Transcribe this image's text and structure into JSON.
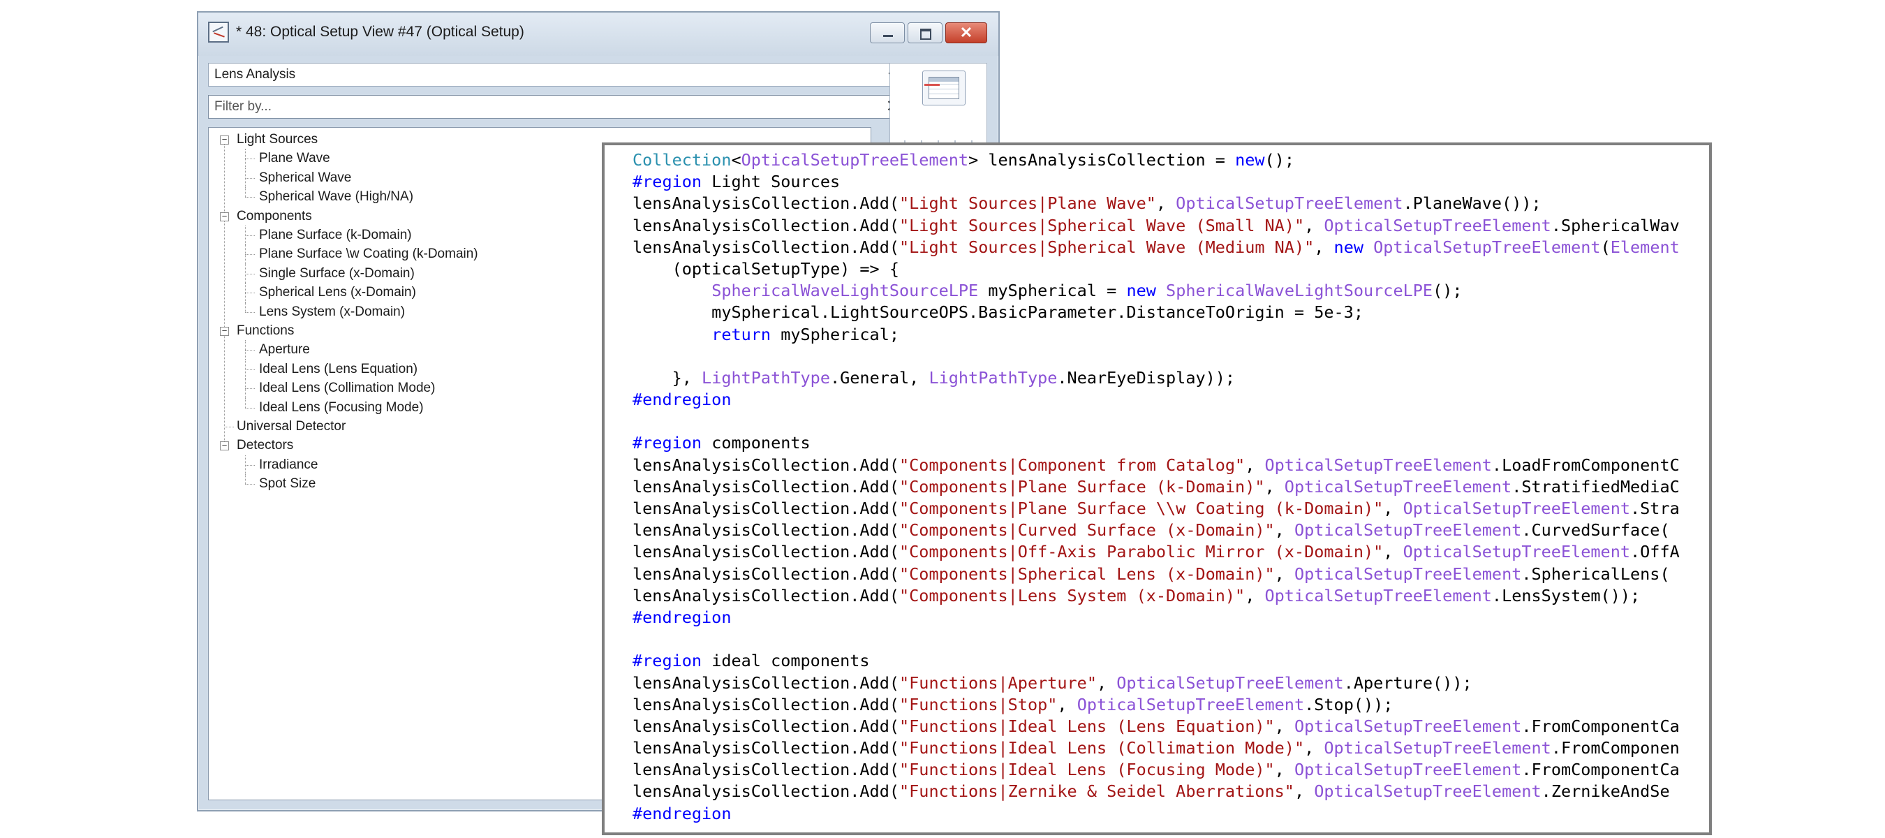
{
  "window": {
    "title": "* 48: Optical Setup View #47 (Optical Setup)"
  },
  "toolbar": {
    "dropdown_value": "Lens Analysis",
    "filter_placeholder": "Filter by...",
    "clear_glyph": "✕"
  },
  "icons": [
    "app-icon",
    "minimize-icon",
    "maximize-icon",
    "close-icon",
    "chevron-down-icon",
    "new-document-icon",
    "table-grid-icon"
  ],
  "tree": [
    {
      "label": "Light Sources",
      "level": 0,
      "expandable": true
    },
    {
      "label": "Plane Wave",
      "level": 1
    },
    {
      "label": "Spherical Wave",
      "level": 1
    },
    {
      "label": "Spherical Wave (High/NA)",
      "level": 1
    },
    {
      "label": "Components",
      "level": 0,
      "expandable": true
    },
    {
      "label": "Plane Surface (k-Domain)",
      "level": 1
    },
    {
      "label": "Plane Surface \\w Coating (k-Domain)",
      "level": 1
    },
    {
      "label": "Single Surface (x-Domain)",
      "level": 1
    },
    {
      "label": "Spherical Lens (x-Domain)",
      "level": 1
    },
    {
      "label": "Lens System (x-Domain)",
      "level": 1
    },
    {
      "label": "Functions",
      "level": 0,
      "expandable": true
    },
    {
      "label": "Aperture",
      "level": 1
    },
    {
      "label": "Ideal Lens (Lens Equation)",
      "level": 1
    },
    {
      "label": "Ideal Lens (Collimation Mode)",
      "level": 1
    },
    {
      "label": "Ideal Lens (Focusing Mode)",
      "level": 1
    },
    {
      "label": "Universal Detector",
      "level": 0,
      "expandable": false
    },
    {
      "label": "Detectors",
      "level": 0,
      "expandable": true
    },
    {
      "label": "Irradiance",
      "level": 1
    },
    {
      "label": "Spot Size",
      "level": 1
    }
  ],
  "colors": {
    "type": "#2b91af",
    "purple": "#8b52d6",
    "string": "#a31515",
    "keyword": "#0000ff",
    "plain": "#000000"
  },
  "code": [
    [
      [
        "type",
        "Collection"
      ],
      [
        "plain",
        "<"
      ],
      [
        "purple",
        "OpticalSetupTreeElement"
      ],
      [
        "plain",
        "> lensAnalysisCollection = "
      ],
      [
        "kw",
        "new"
      ],
      [
        "plain",
        "();"
      ]
    ],
    [
      [
        "kw",
        "#region"
      ],
      [
        "plain",
        " Light Sources"
      ]
    ],
    [
      [
        "plain",
        "lensAnalysisCollection.Add("
      ],
      [
        "string",
        "\"Light Sources|Plane Wave\""
      ],
      [
        "plain",
        ", "
      ],
      [
        "purple",
        "OpticalSetupTreeElement"
      ],
      [
        "plain",
        ".PlaneWave());"
      ]
    ],
    [
      [
        "plain",
        "lensAnalysisCollection.Add("
      ],
      [
        "string",
        "\"Light Sources|Spherical Wave (Small NA)\""
      ],
      [
        "plain",
        ", "
      ],
      [
        "purple",
        "OpticalSetupTreeElement"
      ],
      [
        "plain",
        ".SphericalWav"
      ]
    ],
    [
      [
        "plain",
        "lensAnalysisCollection.Add("
      ],
      [
        "string",
        "\"Light Sources|Spherical Wave (Medium NA)\""
      ],
      [
        "plain",
        ", "
      ],
      [
        "kw",
        "new"
      ],
      [
        "plain",
        " "
      ],
      [
        "purple",
        "OpticalSetupTreeElement"
      ],
      [
        "plain",
        "("
      ],
      [
        "purple",
        "Element"
      ]
    ],
    [
      [
        "plain",
        "    (opticalSetupType) => {"
      ]
    ],
    [
      [
        "plain",
        "        "
      ],
      [
        "purple",
        "SphericalWaveLightSourceLPE"
      ],
      [
        "plain",
        " mySpherical = "
      ],
      [
        "kw",
        "new"
      ],
      [
        "plain",
        " "
      ],
      [
        "purple",
        "SphericalWaveLightSourceLPE"
      ],
      [
        "plain",
        "();"
      ]
    ],
    [
      [
        "plain",
        "        mySpherical.LightSourceOPS.BasicParameter.DistanceToOrigin = 5e-3;"
      ]
    ],
    [
      [
        "plain",
        "        "
      ],
      [
        "kw",
        "return"
      ],
      [
        "plain",
        " mySpherical;"
      ]
    ],
    [
      [
        "plain",
        ""
      ]
    ],
    [
      [
        "plain",
        "    }, "
      ],
      [
        "purple",
        "LightPathType"
      ],
      [
        "plain",
        ".General, "
      ],
      [
        "purple",
        "LightPathType"
      ],
      [
        "plain",
        ".NearEyeDisplay));"
      ]
    ],
    [
      [
        "kw",
        "#endregion"
      ]
    ],
    [
      [
        "plain",
        ""
      ]
    ],
    [
      [
        "kw",
        "#region"
      ],
      [
        "plain",
        " components"
      ]
    ],
    [
      [
        "plain",
        "lensAnalysisCollection.Add("
      ],
      [
        "string",
        "\"Components|Component from Catalog\""
      ],
      [
        "plain",
        ", "
      ],
      [
        "purple",
        "OpticalSetupTreeElement"
      ],
      [
        "plain",
        ".LoadFromComponentC"
      ]
    ],
    [
      [
        "plain",
        "lensAnalysisCollection.Add("
      ],
      [
        "string",
        "\"Components|Plane Surface (k-Domain)\""
      ],
      [
        "plain",
        ", "
      ],
      [
        "purple",
        "OpticalSetupTreeElement"
      ],
      [
        "plain",
        ".StratifiedMediaC"
      ]
    ],
    [
      [
        "plain",
        "lensAnalysisCollection.Add("
      ],
      [
        "string",
        "\"Components|Plane Surface \\\\w Coating (k-Domain)\""
      ],
      [
        "plain",
        ", "
      ],
      [
        "purple",
        "OpticalSetupTreeElement"
      ],
      [
        "plain",
        ".Stra"
      ]
    ],
    [
      [
        "plain",
        "lensAnalysisCollection.Add("
      ],
      [
        "string",
        "\"Components|Curved Surface (x-Domain)\""
      ],
      [
        "plain",
        ", "
      ],
      [
        "purple",
        "OpticalSetupTreeElement"
      ],
      [
        "plain",
        ".CurvedSurface("
      ]
    ],
    [
      [
        "plain",
        "lensAnalysisCollection.Add("
      ],
      [
        "string",
        "\"Components|Off-Axis Parabolic Mirror (x-Domain)\""
      ],
      [
        "plain",
        ", "
      ],
      [
        "purple",
        "OpticalSetupTreeElement"
      ],
      [
        "plain",
        ".OffA"
      ]
    ],
    [
      [
        "plain",
        "lensAnalysisCollection.Add("
      ],
      [
        "string",
        "\"Components|Spherical Lens (x-Domain)\""
      ],
      [
        "plain",
        ", "
      ],
      [
        "purple",
        "OpticalSetupTreeElement"
      ],
      [
        "plain",
        ".SphericalLens("
      ]
    ],
    [
      [
        "plain",
        "lensAnalysisCollection.Add("
      ],
      [
        "string",
        "\"Components|Lens System (x-Domain)\""
      ],
      [
        "plain",
        ", "
      ],
      [
        "purple",
        "OpticalSetupTreeElement"
      ],
      [
        "plain",
        ".LensSystem());"
      ]
    ],
    [
      [
        "kw",
        "#endregion"
      ]
    ],
    [
      [
        "plain",
        ""
      ]
    ],
    [
      [
        "kw",
        "#region"
      ],
      [
        "plain",
        " ideal components"
      ]
    ],
    [
      [
        "plain",
        "lensAnalysisCollection.Add("
      ],
      [
        "string",
        "\"Functions|Aperture\""
      ],
      [
        "plain",
        ", "
      ],
      [
        "purple",
        "OpticalSetupTreeElement"
      ],
      [
        "plain",
        ".Aperture());"
      ]
    ],
    [
      [
        "plain",
        "lensAnalysisCollection.Add("
      ],
      [
        "string",
        "\"Functions|Stop\""
      ],
      [
        "plain",
        ", "
      ],
      [
        "purple",
        "OpticalSetupTreeElement"
      ],
      [
        "plain",
        ".Stop());"
      ]
    ],
    [
      [
        "plain",
        "lensAnalysisCollection.Add("
      ],
      [
        "string",
        "\"Functions|Ideal Lens (Lens Equation)\""
      ],
      [
        "plain",
        ", "
      ],
      [
        "purple",
        "OpticalSetupTreeElement"
      ],
      [
        "plain",
        ".FromComponentCa"
      ]
    ],
    [
      [
        "plain",
        "lensAnalysisCollection.Add("
      ],
      [
        "string",
        "\"Functions|Ideal Lens (Collimation Mode)\""
      ],
      [
        "plain",
        ", "
      ],
      [
        "purple",
        "OpticalSetupTreeElement"
      ],
      [
        "plain",
        ".FromComponen"
      ]
    ],
    [
      [
        "plain",
        "lensAnalysisCollection.Add("
      ],
      [
        "string",
        "\"Functions|Ideal Lens (Focusing Mode)\""
      ],
      [
        "plain",
        ", "
      ],
      [
        "purple",
        "OpticalSetupTreeElement"
      ],
      [
        "plain",
        ".FromComponentCa"
      ]
    ],
    [
      [
        "plain",
        "lensAnalysisCollection.Add("
      ],
      [
        "string",
        "\"Functions|Zernike & Seidel Aberrations\""
      ],
      [
        "plain",
        ", "
      ],
      [
        "purple",
        "OpticalSetupTreeElement"
      ],
      [
        "plain",
        ".ZernikeAndSe"
      ]
    ],
    [
      [
        "kw",
        "#endregion"
      ]
    ]
  ]
}
